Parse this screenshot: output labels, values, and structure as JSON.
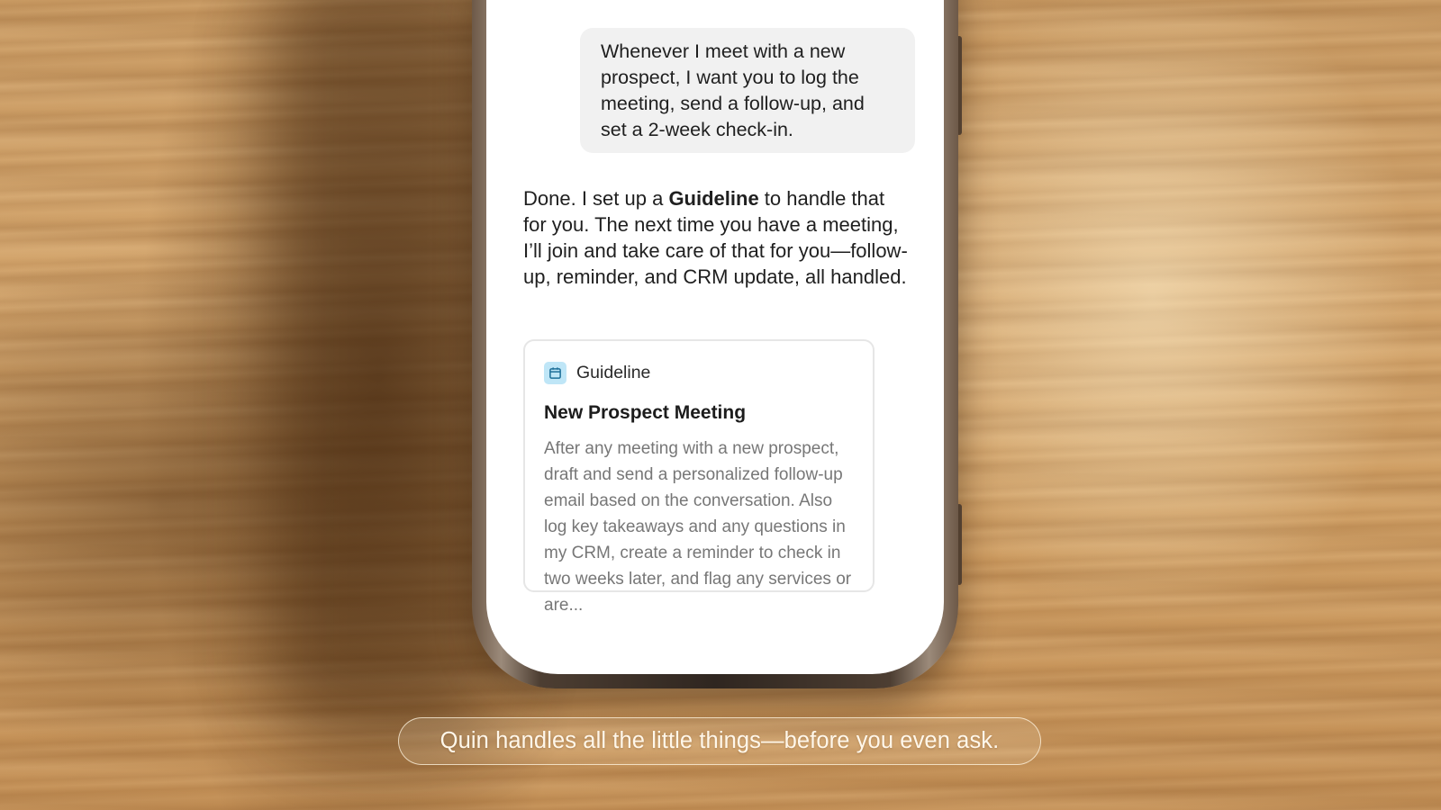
{
  "conversation": {
    "user_message": "Whenever I meet with a new prospect, I want you to log the meeting, send a follow-up, and set a 2-week check-in.",
    "assistant_reply": {
      "before": "Done. I set up a ",
      "bold": "Guideline",
      "after": " to handle that for you. The next time you have a meeting, I’ll join and take care of that for you—follow-up, reminder, and CRM update, all handled."
    }
  },
  "guideline_card": {
    "label": "Guideline",
    "icon": "calendar-icon",
    "icon_color": "#bfe6f7",
    "title": "New Prospect Meeting",
    "description": "After any meeting with a new prospect, draft and send a personalized follow-up email based on the conversation. Also log key takeaways and any questions in my CRM, create a reminder to check in two weeks later, and flag any services or are..."
  },
  "caption": "Quin handles all the little things—before you even ask."
}
